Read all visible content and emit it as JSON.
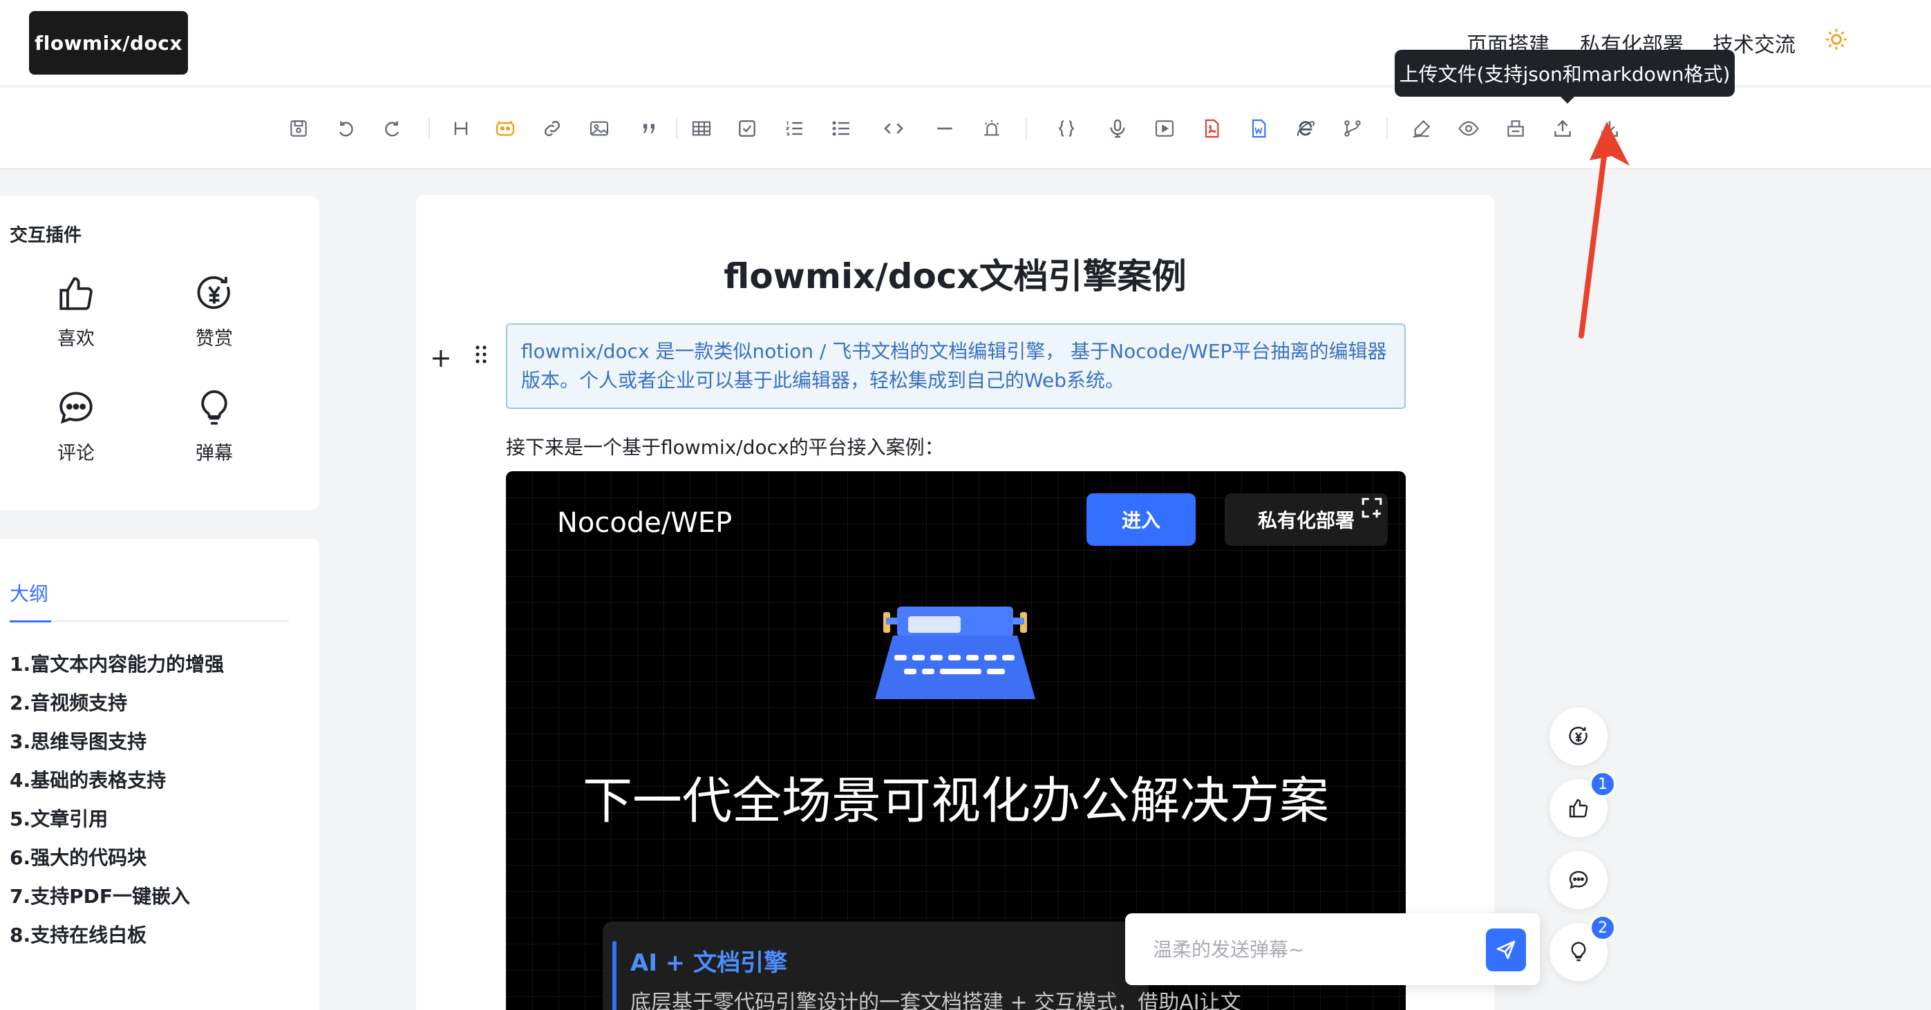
{
  "header": {
    "logo": "flowmix/docx",
    "nav": [
      "页面搭建",
      "私有化部署",
      "技术交流"
    ],
    "theme_icon": "sun-icon"
  },
  "toolbar": {
    "tooltip": "上传文件(支持json和markdown格式)",
    "icons": [
      "save-icon",
      "undo-icon",
      "redo-icon",
      "heading-icon",
      "emoji-icon",
      "link-icon",
      "image-icon",
      "quote-icon",
      "table-icon",
      "checkbox-icon",
      "ordered-list-icon",
      "bullet-list-icon",
      "code-icon",
      "divider-icon",
      "alert-icon",
      "code-block-icon",
      "audio-icon",
      "video-icon",
      "pdf-icon",
      "word-icon",
      "ie-icon",
      "branch-icon",
      "draw-icon",
      "preview-icon",
      "print-icon",
      "upload-icon",
      "download-icon"
    ]
  },
  "plugins": {
    "title": "交互插件",
    "items": [
      {
        "label": "喜欢",
        "icon": "thumbs-up-icon"
      },
      {
        "label": "赞赏",
        "icon": "yen-coin-icon"
      },
      {
        "label": "评论",
        "icon": "comment-icon"
      },
      {
        "label": "弹幕",
        "icon": "lightbulb-icon"
      }
    ]
  },
  "outline": {
    "title": "大纲",
    "items": [
      "1.富文本内容能力的增强",
      "2.音视频支持",
      "3.思维导图支持",
      "4.基础的表格支持",
      "5.文章引用",
      "6.强大的代码块",
      "7.支持PDF一键嵌入",
      "8.支持在线白板"
    ]
  },
  "doc": {
    "title": "flowmix/docx文档引擎案例",
    "callout": "flowmix/docx 是一款类似notion / 飞书文档的文档编辑引擎， 基于Nocode/WEP平台抽离的编辑器版本。个人或者企业可以基于此编辑器，轻松集成到自己的Web系统。",
    "paragraph": "接下来是一个基于flowmix/docx的平台接入案例：",
    "banner": {
      "brand": "Nocode/WEP",
      "enter": "进入",
      "private": "私有化部署",
      "headline": "下一代全场景可视化办公解决方案",
      "card_title": "AI + 文档引擎",
      "card_desc": "底层基于零代码引擎设计的一套文档搭建 + 交互模式，借助AI让文"
    }
  },
  "side_actions": {
    "like_count": "1",
    "idea_count": "2"
  },
  "danmaku": {
    "placeholder": "温柔的发送弹幕~"
  },
  "colors": {
    "accent": "#3370ff",
    "annotation_arrow": "#e8412c",
    "callout_bg": "#eef5fb",
    "callout_text": "#3a72c0"
  }
}
